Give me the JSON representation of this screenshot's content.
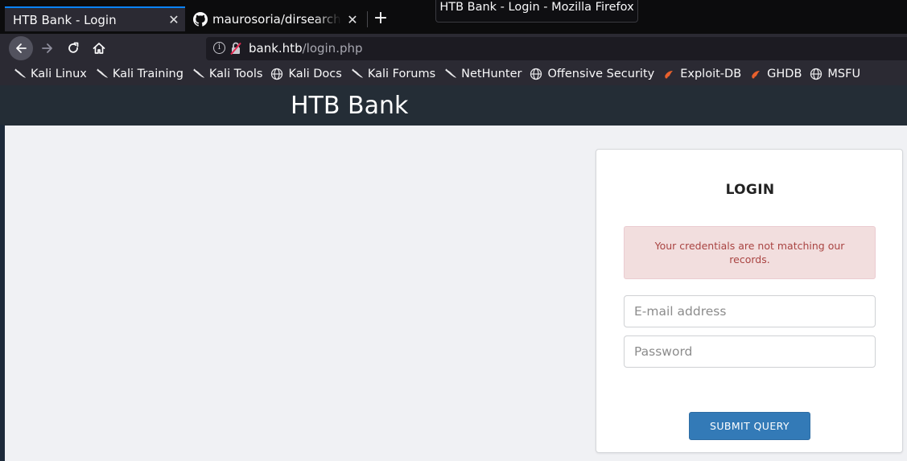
{
  "browser": {
    "tabs": [
      {
        "label": "HTB Bank - Login",
        "active": true
      },
      {
        "label": "maurosoria/dirsearch: W",
        "active": false
      }
    ],
    "tooltip": "HTB Bank - Login - Mozilla Firefox",
    "url": {
      "host": "bank.htb",
      "path": "/login.php"
    },
    "bookmarks": [
      {
        "label": "Kali Linux",
        "icon": "kali-dragon-icon"
      },
      {
        "label": "Kali Training",
        "icon": "kali-dragon-icon"
      },
      {
        "label": "Kali Tools",
        "icon": "kali-dragon-icon"
      },
      {
        "label": "Kali Docs",
        "icon": "globe-icon"
      },
      {
        "label": "Kali Forums",
        "icon": "kali-dragon-icon"
      },
      {
        "label": "NetHunter",
        "icon": "kali-dragon-icon"
      },
      {
        "label": "Offensive Security",
        "icon": "globe-icon"
      },
      {
        "label": "Exploit-DB",
        "icon": "exploitdb-icon"
      },
      {
        "label": "GHDB",
        "icon": "exploitdb-icon"
      },
      {
        "label": "MSFU",
        "icon": "globe-icon"
      }
    ]
  },
  "page": {
    "site_title": "HTB Bank",
    "login": {
      "title": "LOGIN",
      "error": "Your credentials are not matching our records.",
      "email_placeholder": "E-mail address",
      "password_placeholder": "Password",
      "submit_label": "SUBMIT QUERY"
    }
  },
  "colors": {
    "header": "#242d36",
    "accent": "#0a84ff",
    "button": "#337ab7",
    "alert_bg": "#f2dede",
    "alert_text": "#a94442"
  }
}
